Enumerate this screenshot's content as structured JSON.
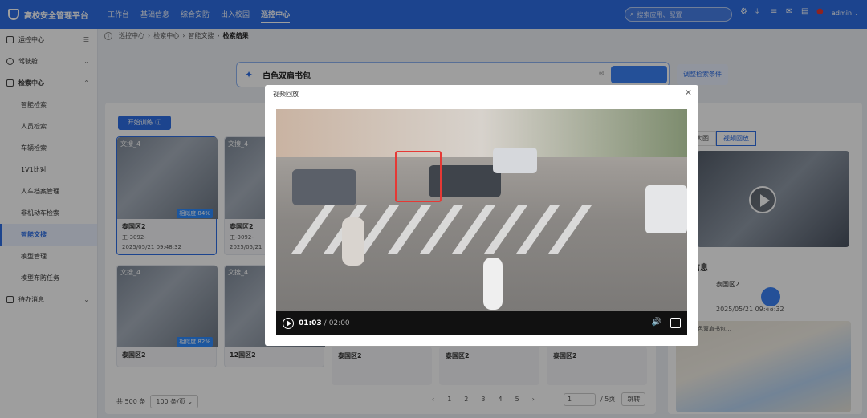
{
  "app": {
    "title": "高校安全管理平台"
  },
  "nav": [
    "工作台",
    "基础信息",
    "综合安防",
    "出入校园",
    "巡控中心"
  ],
  "search": {
    "placeholder": "搜索应用、配置"
  },
  "user": {
    "name": "admin"
  },
  "sidebar": {
    "items": [
      {
        "label": "运控中心"
      },
      {
        "label": "驾驶舱"
      },
      {
        "label": "检索中心"
      },
      {
        "label": "待办消息"
      }
    ],
    "sub": [
      "智能检索",
      "人员检索",
      "车辆检索",
      "1V1比对",
      "人车档案管理",
      "非机动车检索",
      "智能文搜",
      "模型管理",
      "模型布防任务"
    ]
  },
  "breadcrumb": [
    "巡控中心",
    "检索中心",
    "智能文搜",
    "检索结果"
  ],
  "query": {
    "text": "白色双肩书包"
  },
  "adjust": {
    "label": "调整检索条件"
  },
  "start": {
    "label": "开始训练"
  },
  "cards": [
    {
      "tag": "文搜_4",
      "loc": "泰国区2",
      "dev": "工-3092-",
      "time": "2025/05/21 09:48:32",
      "score": "相似度 84%"
    },
    {
      "tag": "文搜_4",
      "loc": "泰国区2",
      "dev": "工-3092-",
      "time": "2025/05/21"
    },
    {
      "tag": "文搜_4",
      "loc": "泰国区2",
      "dev": "",
      "time": "",
      "score": "相似度 82%"
    },
    {
      "tag": "文搜_4",
      "loc": "12国区2",
      "dev": "",
      "time": ""
    }
  ],
  "minis": [
    {
      "loc": "泰国区2"
    },
    {
      "loc": "泰国区2"
    },
    {
      "loc": "泰国区2"
    }
  ],
  "pager": {
    "total": "共 500 条",
    "size": "100 条/页",
    "pages": [
      "1",
      "2",
      "3",
      "4",
      "5"
    ],
    "jump": "1",
    "of": "/ 5页",
    "go": "跳转"
  },
  "right": {
    "tab_image": "大图",
    "tab_video": "视频回放",
    "info_title": "信息",
    "loc": "泰国区2",
    "time": "2025/05/21 09:48:32",
    "map_desc": "白色双肩书包…"
  },
  "modal": {
    "title": "视频回放",
    "time_current": "01:03",
    "time_total": "02:00",
    "progress": 0.525
  }
}
